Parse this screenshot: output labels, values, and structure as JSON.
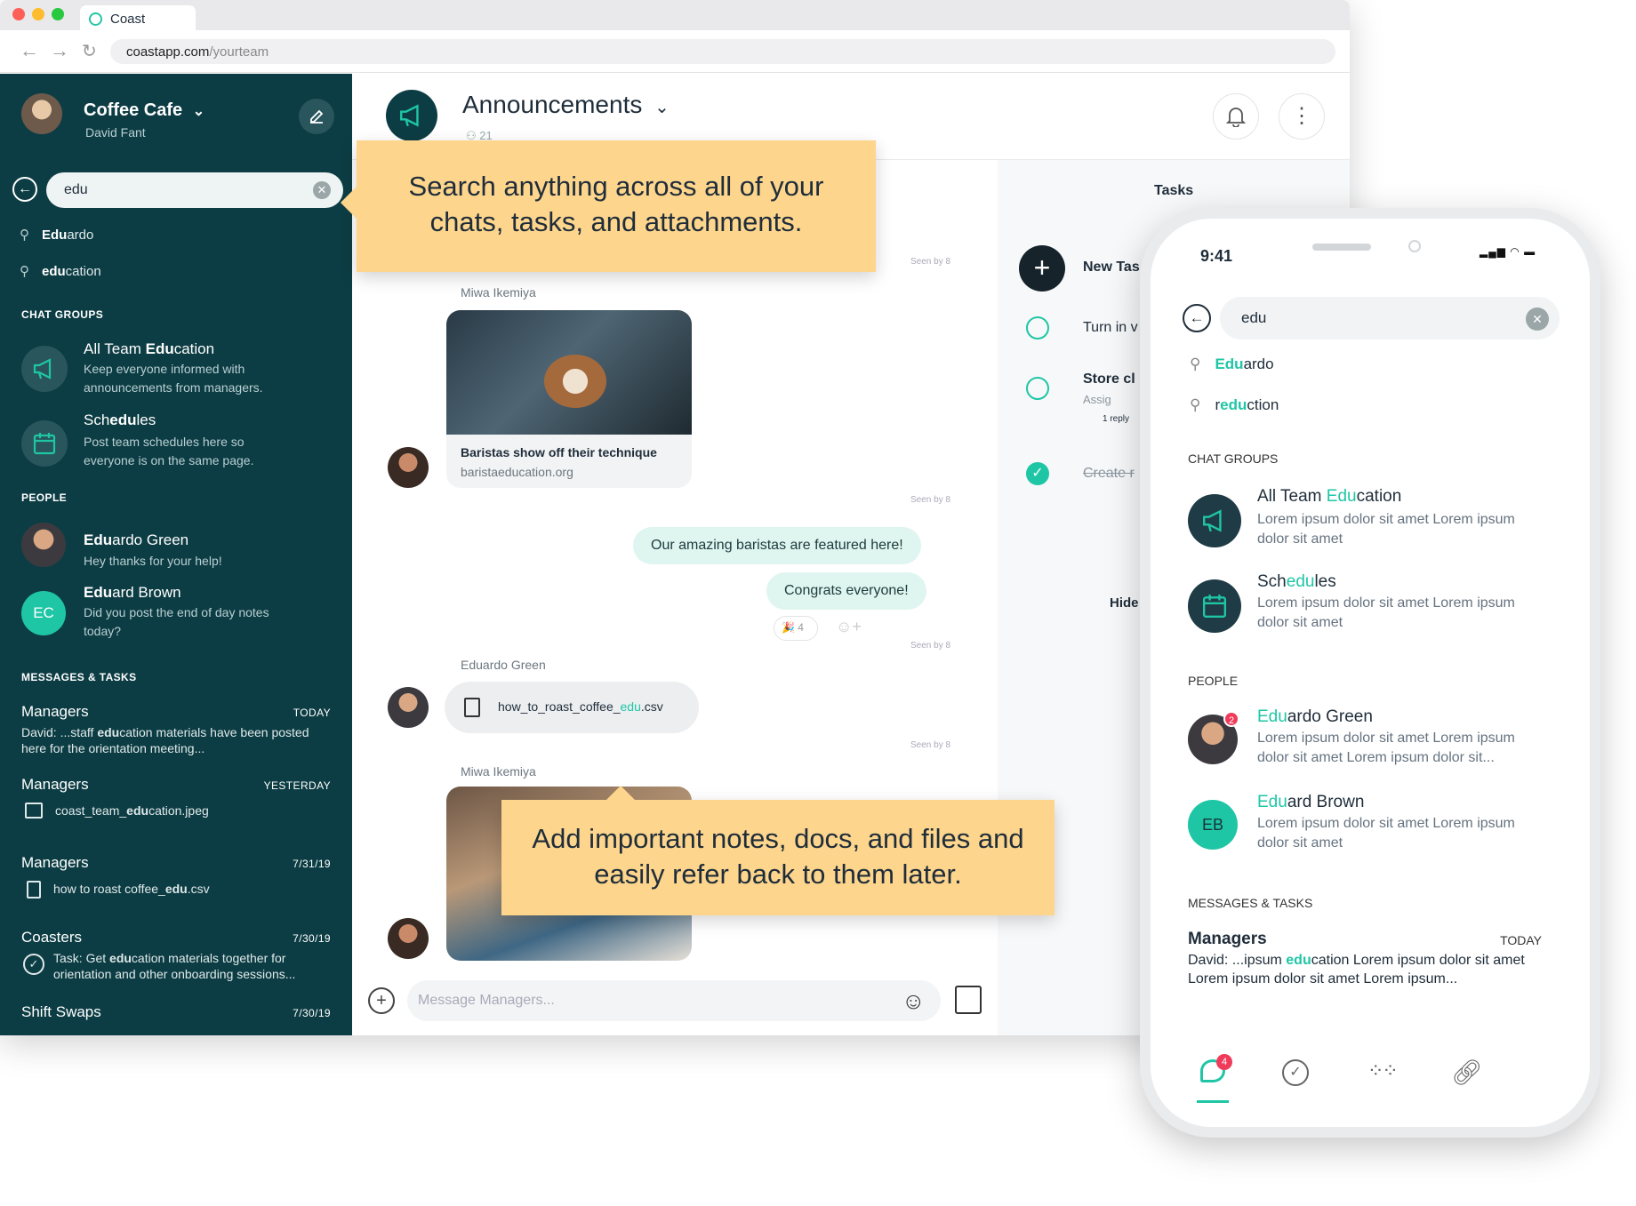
{
  "browser": {
    "tab_title": "Coast",
    "url_host": "coastapp.com",
    "url_path": "/yourteam"
  },
  "sidebar": {
    "team_name": "Coffee Cafe",
    "user_name": "David Fant",
    "search_value": "edu",
    "suggestions": [
      {
        "match": "Edu",
        "rest": "ardo"
      },
      {
        "match": "edu",
        "rest": "cation"
      }
    ],
    "section_chat_groups": "CHAT GROUPS",
    "chat_groups": [
      {
        "pre": "All Team ",
        "match": "Edu",
        "post": "cation",
        "desc": "Keep everyone informed with announcements from managers."
      },
      {
        "pre": "Sch",
        "match": "edu",
        "post": "les",
        "desc": "Post team schedules here so everyone is on the same page."
      }
    ],
    "section_people": "PEOPLE",
    "people": [
      {
        "match": "Edu",
        "post": "ardo Green",
        "desc": "Hey thanks for your help!"
      },
      {
        "initials": "EC",
        "match": "Edu",
        "post": "ard Brown",
        "desc": "Did you post the end of day notes today?"
      }
    ],
    "section_messages": "MESSAGES & TASKS",
    "messages": [
      {
        "title": "Managers",
        "date": "TODAY",
        "pre": "David: ...staff ",
        "match": "edu",
        "post": "cation materials have been posted here for the orientation meeting..."
      },
      {
        "title": "Managers",
        "date": "YESTERDAY",
        "pre": "coast_team_",
        "match": "edu",
        "post": "cation.jpeg"
      },
      {
        "title": "Managers",
        "date": "7/31/19",
        "pre": "how to roast coffee_",
        "match": "edu",
        "post": ".csv"
      },
      {
        "title": "Coasters",
        "date": "7/30/19",
        "pre": "Task: Get ",
        "match": "edu",
        "post": "cation materials together for orientation and other onboarding sessions..."
      },
      {
        "title": "Shift Swaps",
        "date": "7/30/19"
      }
    ]
  },
  "channel": {
    "title": "Announcements",
    "member_count": "21",
    "composer_placeholder": "Message Managers..."
  },
  "chat": {
    "seen": "Seen by 8",
    "sender1": "Miwa Ikemiya",
    "link_title": "Baristas show off their technique",
    "link_url": "baristaeducation.org",
    "bubble1": "Our amazing baristas are featured here!",
    "bubble2": "Congrats everyone!",
    "reaction_count": "4",
    "sender2": "Eduardo Green",
    "file_pre": "how_to_roast_coffee_",
    "file_match": "edu",
    "file_post": ".csv",
    "sender3": "Miwa Ikemiya"
  },
  "tasks_panel": {
    "title": "Tasks",
    "new_task": "New Tas",
    "task1": "Turn in v",
    "task2": "Store cl",
    "task2_meta": "Assig",
    "task2_reply": "1 reply",
    "task3": "Create r",
    "hide": "Hide"
  },
  "callouts": {
    "search": "Search anything across all of your chats, tasks, and attachments.",
    "notes": "Add important notes, docs, and files and easily refer back to them later."
  },
  "phone": {
    "time": "9:41",
    "search_value": "edu",
    "suggestions": [
      {
        "pre": "",
        "match": "Edu",
        "post": "ardo"
      },
      {
        "pre": "r",
        "match": "edu",
        "post": "ction"
      }
    ],
    "section_chat_groups": "CHAT GROUPS",
    "chat_groups": [
      {
        "pre": "All Team ",
        "match": "Edu",
        "post": "cation",
        "desc": "Lorem ipsum dolor sit amet Lorem ipsum dolor sit amet"
      },
      {
        "pre": "Sch",
        "match": "edu",
        "post": "les",
        "desc": "Lorem ipsum dolor sit amet Lorem ipsum dolor sit amet"
      }
    ],
    "section_people": "PEOPLE",
    "people": [
      {
        "match": "Edu",
        "post": "ardo Green",
        "badge": "2",
        "desc": "Lorem ipsum dolor sit amet Lorem ipsum dolor sit amet Lorem ipsum dolor sit..."
      },
      {
        "initials": "EB",
        "match": "Edu",
        "post": "ard Brown",
        "desc": "Lorem ipsum dolor sit amet Lorem ipsum dolor sit amet"
      }
    ],
    "section_messages": "MESSAGES & TASKS",
    "message": {
      "title": "Managers",
      "date": "TODAY",
      "pre": "David: ...ipsum ",
      "match": "edu",
      "post": "cation Lorem ipsum dolor sit amet Lorem ipsum dolor sit amet Lorem ipsum..."
    },
    "tab_badge": "4"
  },
  "colors": {
    "sidebar": "#0d3d44",
    "accent": "#1fc6a6",
    "callout": "#fdd58c"
  }
}
